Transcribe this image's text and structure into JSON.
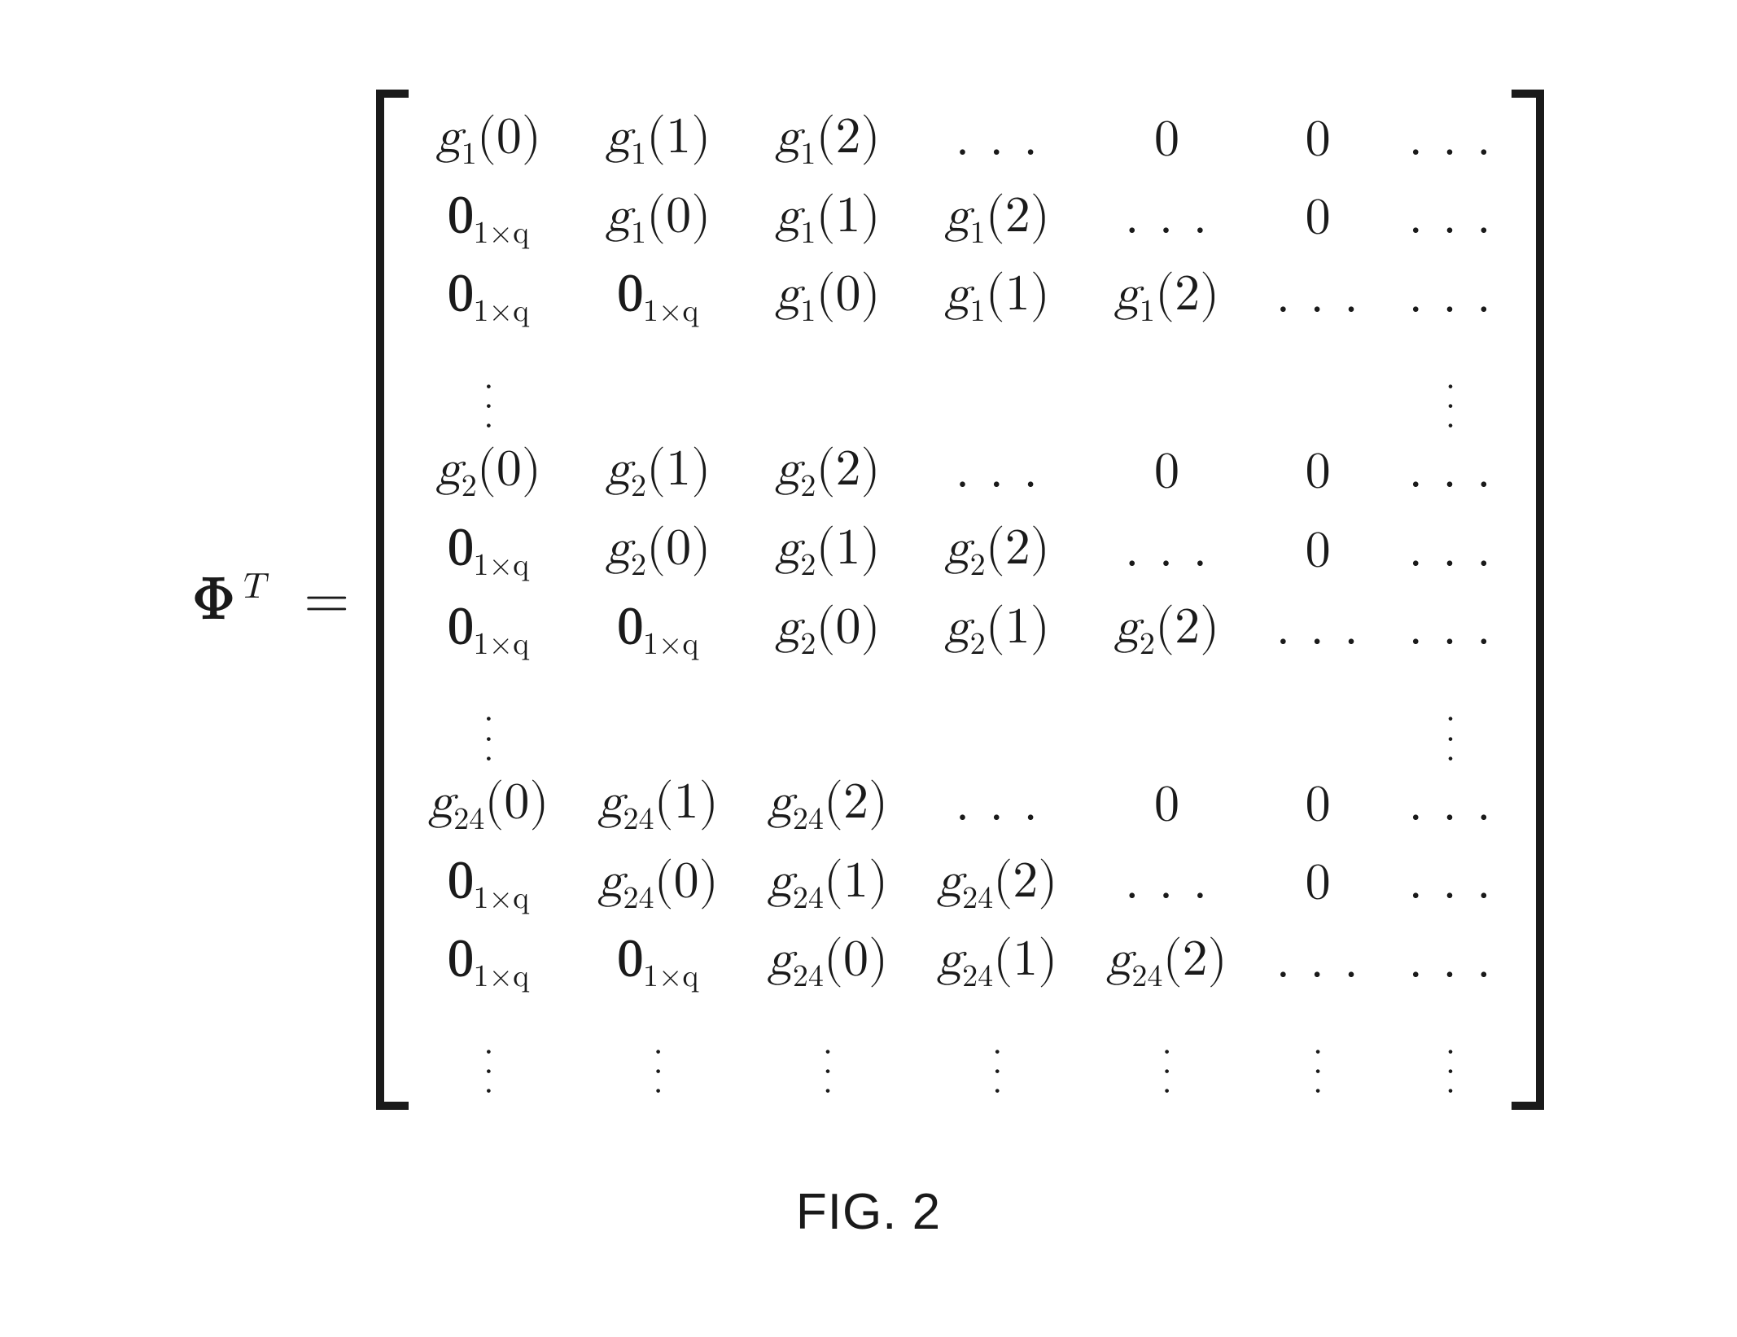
{
  "lhs": {
    "symbol": "Φ",
    "superscript": "T",
    "equals": "="
  },
  "zero_block": {
    "bold_zero": "0",
    "subscript": "1×q"
  },
  "g": {
    "var": "g",
    "subs": {
      "r1": "1",
      "r2": "2",
      "r3": "24"
    },
    "args": {
      "a0": "0",
      "a1": "1",
      "a2": "2"
    }
  },
  "symbols": {
    "zero": "0",
    "hdots": ". . .",
    "vbullet": "."
  },
  "caption": "FIG. 2",
  "matrix_structure": {
    "rows": 13,
    "cols": 7,
    "note": "Block-Toeplitz dictionary matrix with 24 shifted filter blocks; entries are g_k(n), 0_{1×q}, scalar 0, horizontal dots, vertical dots."
  }
}
